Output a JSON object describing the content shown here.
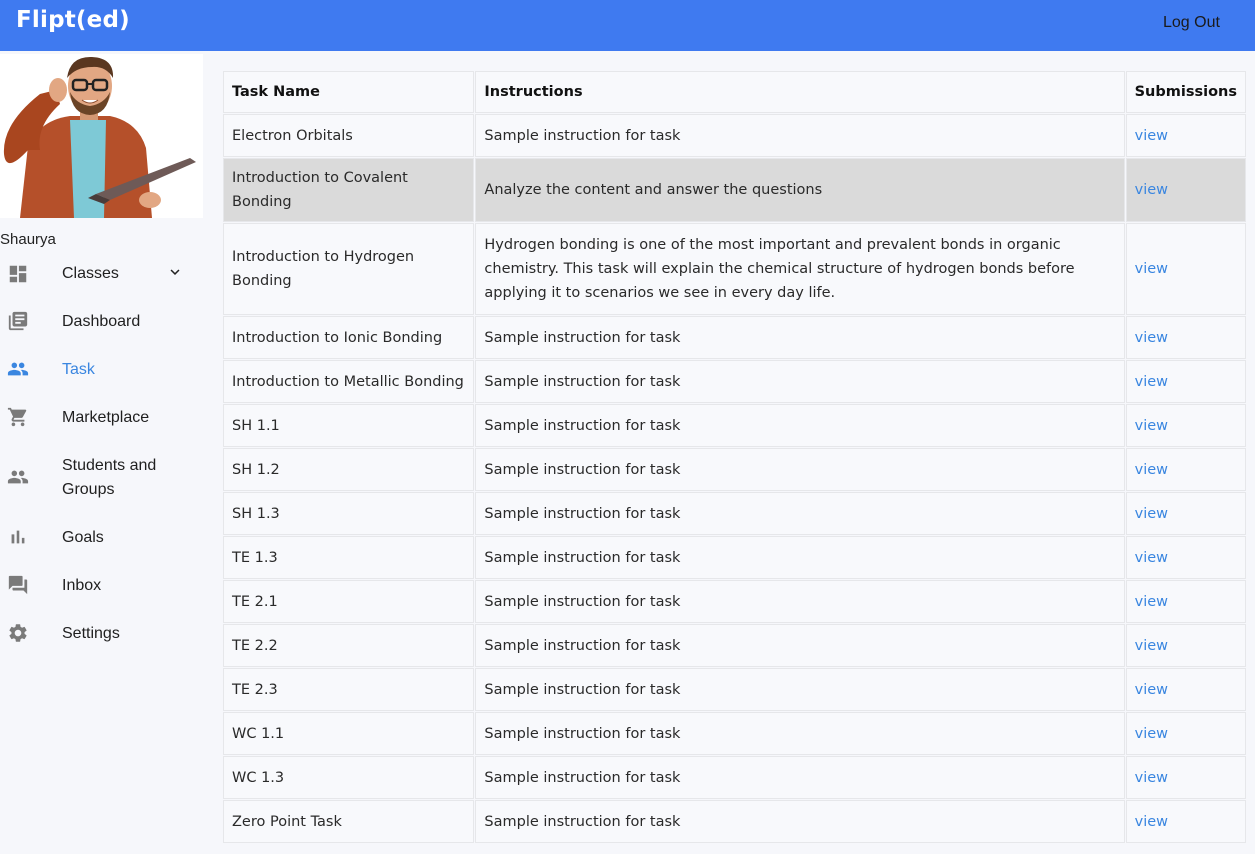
{
  "app": {
    "logo": "Flipt(ed)",
    "logout_label": "Log Out"
  },
  "user": {
    "name": "Shaurya"
  },
  "sidebar": {
    "items": [
      {
        "label": "Classes",
        "icon": "dashboard-grid-icon",
        "expandable": true
      },
      {
        "label": "Dashboard",
        "icon": "library-books-icon"
      },
      {
        "label": "Task",
        "icon": "people-icon",
        "active": true
      },
      {
        "label": "Marketplace",
        "icon": "shopping-cart-icon"
      },
      {
        "label": "Students and Groups",
        "icon": "people-icon"
      },
      {
        "label": "Goals",
        "icon": "bar-chart-icon"
      },
      {
        "label": "Inbox",
        "icon": "forum-icon"
      },
      {
        "label": "Settings",
        "icon": "gear-icon"
      }
    ],
    "active_color": "#3a86e0"
  },
  "table": {
    "headers": [
      "Task Name",
      "Instructions",
      "Submissions"
    ],
    "rows": [
      {
        "name": "Electron Orbitals",
        "instructions": "Sample instruction for task",
        "link": "view"
      },
      {
        "name": "Introduction to Covalent Bonding",
        "instructions": "Analyze the content and answer the questions",
        "link": "view",
        "highlighted": true
      },
      {
        "name": "Introduction to Hydrogen Bonding",
        "instructions": "Hydrogen bonding is one of the most important and prevalent bonds in organic chemistry. This task will explain the chemical structure of hydrogen bonds before applying it to scenarios we see in every day life.",
        "link": "view"
      },
      {
        "name": "Introduction to Ionic Bonding",
        "instructions": "Sample instruction for task",
        "link": "view"
      },
      {
        "name": "Introduction to Metallic Bonding",
        "instructions": "Sample instruction for task",
        "link": "view"
      },
      {
        "name": "SH 1.1",
        "instructions": "Sample instruction for task",
        "link": "view"
      },
      {
        "name": "SH 1.2",
        "instructions": "Sample instruction for task",
        "link": "view"
      },
      {
        "name": "SH 1.3",
        "instructions": "Sample instruction for task",
        "link": "view"
      },
      {
        "name": "TE 1.3",
        "instructions": "Sample instruction for task",
        "link": "view"
      },
      {
        "name": "TE 2.1",
        "instructions": "Sample instruction for task",
        "link": "view"
      },
      {
        "name": "TE 2.2",
        "instructions": "Sample instruction for task",
        "link": "view"
      },
      {
        "name": "TE 2.3",
        "instructions": "Sample instruction for task",
        "link": "view"
      },
      {
        "name": "WC 1.1",
        "instructions": "Sample instruction for task",
        "link": "view"
      },
      {
        "name": "WC 1.3",
        "instructions": "Sample instruction for task",
        "link": "view"
      },
      {
        "name": "Zero Point Task",
        "instructions": "Sample instruction for task",
        "link": "view"
      }
    ]
  },
  "colors": {
    "topbar": "#3f7af0",
    "link": "#3a86e0",
    "highlight_row": "#dadada"
  }
}
